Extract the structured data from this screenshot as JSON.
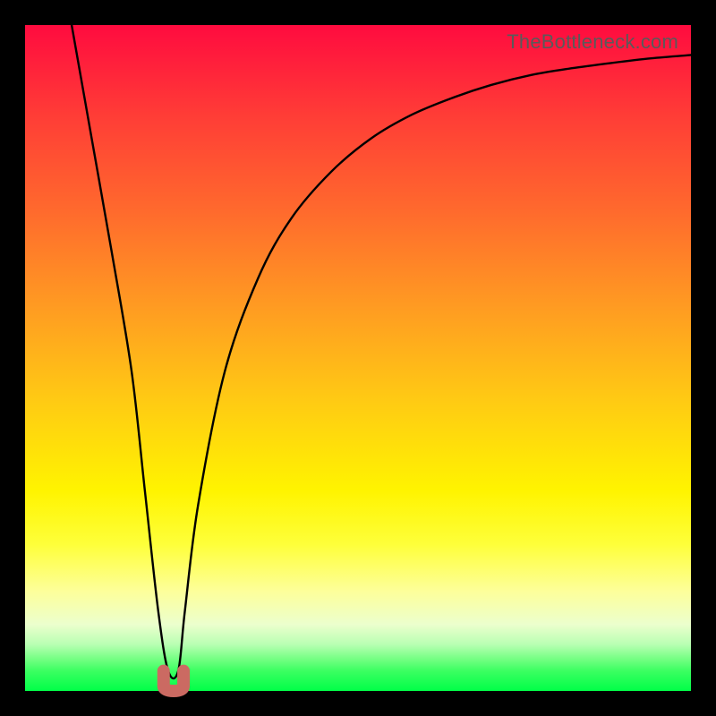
{
  "watermark": "TheBottleneck.com",
  "colors": {
    "frame_bg_top": "#ff0b3f",
    "frame_bg_bottom": "#00ff48",
    "curve_stroke": "#000000",
    "nub_stroke": "#cb6a62",
    "page_bg": "#000000",
    "watermark_text": "#5a5a5a"
  },
  "chart_data": {
    "type": "line",
    "title": "",
    "xlabel": "",
    "ylabel": "",
    "xlim": [
      0,
      100
    ],
    "ylim": [
      0,
      100
    ],
    "grid": false,
    "legend": false,
    "notes": "Axes are implicit (no tick labels shown). x runs left→right across the gradient panel; y runs bottom→top (0 at the green edge, 100 at the red edge). Values are read off the curve's position relative to panel edges.",
    "series": [
      {
        "name": "bottleneck-curve",
        "x": [
          7,
          10,
          13,
          16,
          18,
          20,
          21.5,
          23,
          24,
          26,
          30,
          35,
          40,
          46,
          52,
          58,
          64,
          70,
          76,
          82,
          88,
          94,
          100
        ],
        "y": [
          100,
          83,
          66,
          48,
          30,
          12,
          3,
          3,
          12,
          28,
          48,
          62,
          71,
          78,
          83,
          86.5,
          89,
          91,
          92.5,
          93.5,
          94.3,
          95,
          95.5
        ]
      }
    ],
    "marker": {
      "name": "minimum-nub",
      "x": 22.3,
      "y": 3,
      "width_x": 3,
      "depth_y": 3,
      "color": "#cb6a62"
    }
  }
}
